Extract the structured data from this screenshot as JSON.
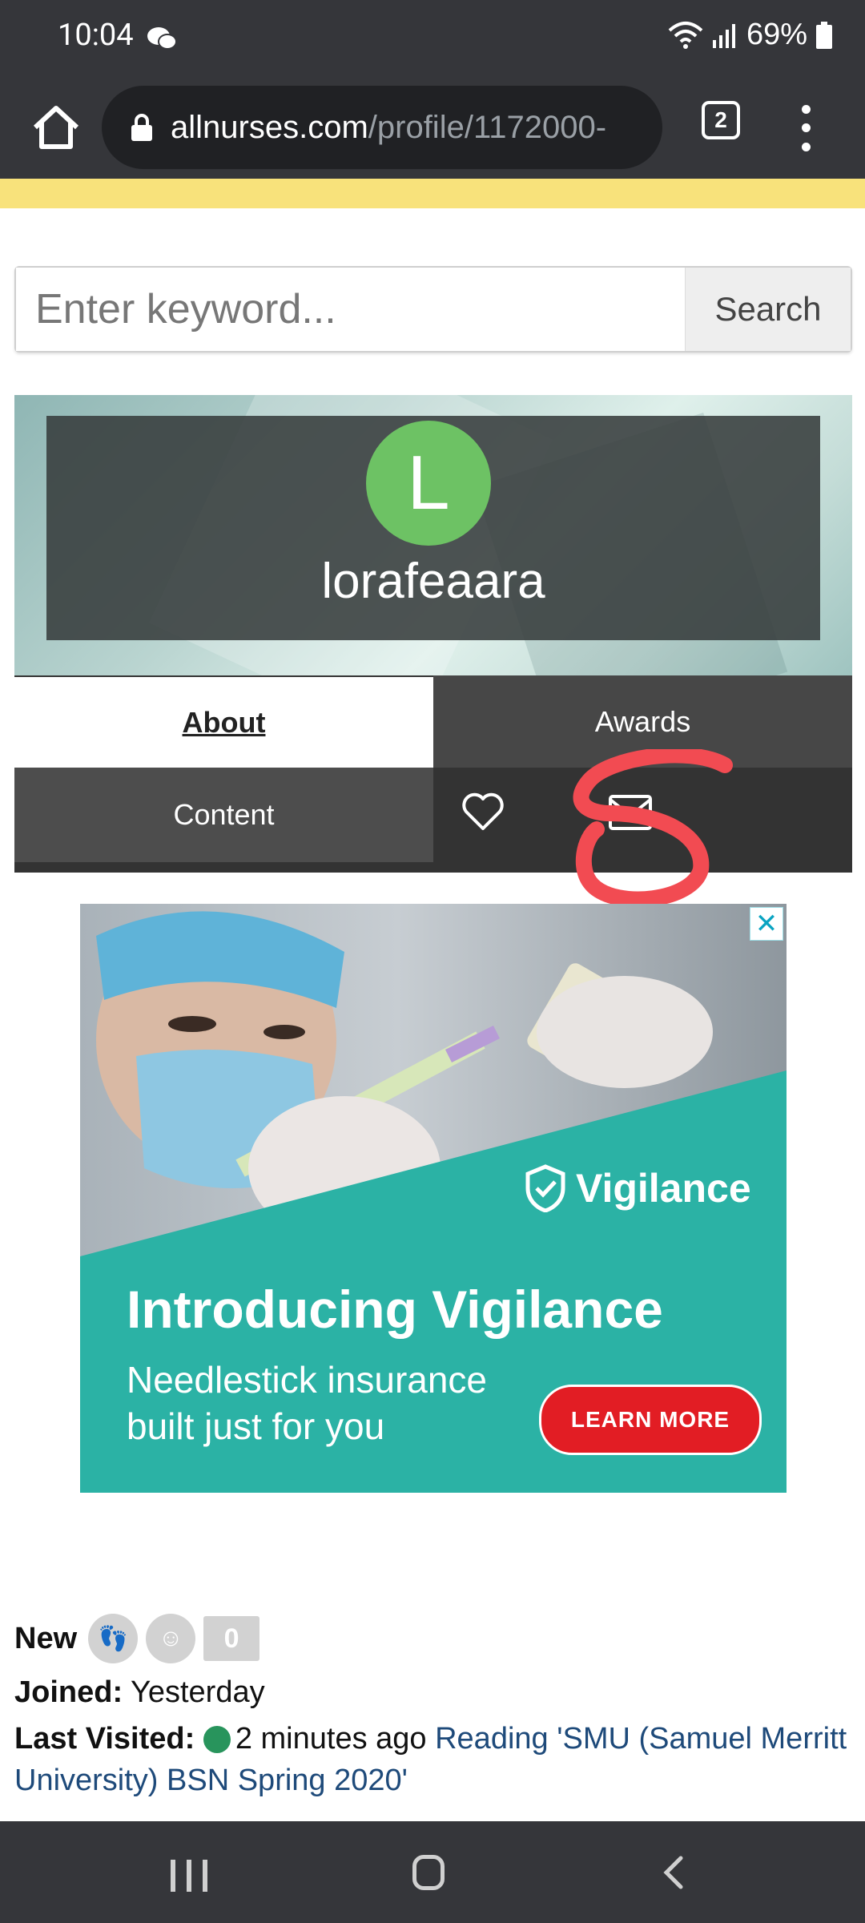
{
  "status": {
    "time": "10:04",
    "battery": "69%"
  },
  "browser": {
    "url_domain": "allnurses.com",
    "url_path": "/profile/1172000-",
    "tab_count": "2"
  },
  "search": {
    "placeholder": "Enter keyword...",
    "button_label": "Search"
  },
  "profile": {
    "avatar_letter": "L",
    "username": "lorafeaara"
  },
  "tabs": {
    "about": "About",
    "awards": "Awards",
    "content": "Content"
  },
  "ad": {
    "brand": "Vigilance",
    "headline": "Introducing Vigilance",
    "subline1": "Needlestick insurance",
    "subline2": "built just for you",
    "cta": "LEARN MORE",
    "close": "✕"
  },
  "info": {
    "rank": "New",
    "post_count": "0",
    "joined_label": "Joined:",
    "joined_value": "Yesterday",
    "visited_label": "Last Visited:",
    "visited_time": "2 minutes ago",
    "visited_activity": "Reading 'SMU (Samuel Merritt University) BSN Spring 2020'"
  },
  "colors": {
    "avatar": "#6dc264",
    "yellow_bar": "#f8e27b",
    "ad_teal": "#2bb2a5",
    "cta_red": "#e21d24",
    "online": "#28945c"
  }
}
